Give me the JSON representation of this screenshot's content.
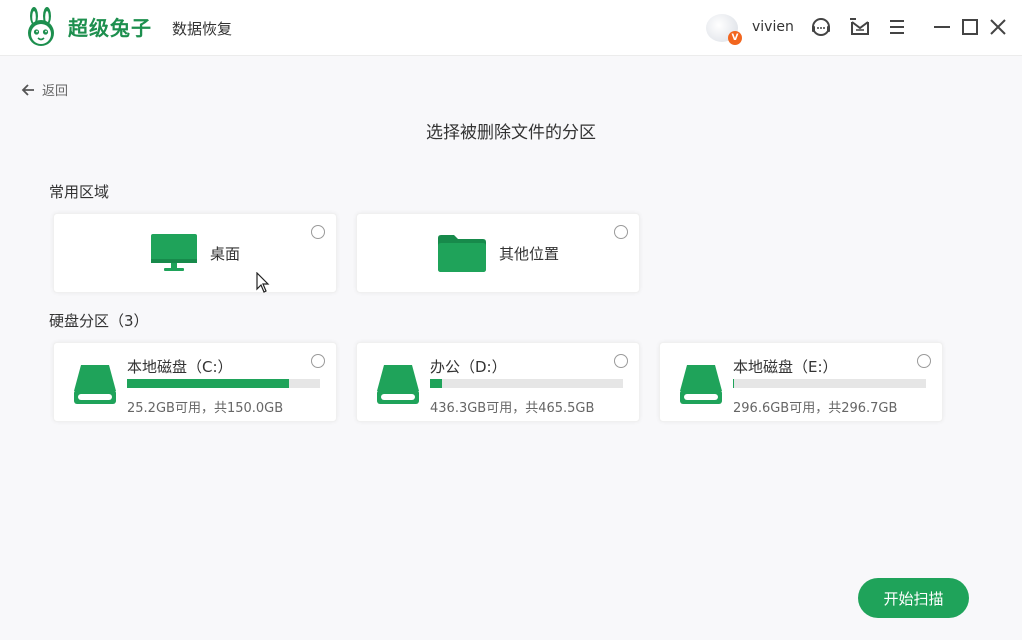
{
  "app": {
    "brand": "超级兔子",
    "subtitle": "数据恢复",
    "username": "vivien",
    "vip_badge": "V"
  },
  "icons": {
    "logo": "rabbit-logo-icon",
    "support": "headset-icon",
    "message": "mail-icon",
    "menu": "hamburger-menu-icon",
    "minimize": "minimize-icon",
    "maximize": "maximize-icon",
    "close": "close-icon",
    "back": "arrow-left-icon",
    "desktop": "monitor-icon",
    "other": "folder-icon",
    "drive": "hard-drive-icon"
  },
  "nav": {
    "back_label": "返回"
  },
  "page": {
    "title": "选择被删除文件的分区"
  },
  "common": {
    "label": "常用区域",
    "items": [
      {
        "label": "桌面"
      },
      {
        "label": "其他位置"
      }
    ]
  },
  "partitions": {
    "label": "硬盘分区（3）",
    "items": [
      {
        "name": "本地磁盘（C:）",
        "size": "25.2GB可用，共150.0GB",
        "used_fraction": 0.84
      },
      {
        "name": "办公（D:）",
        "size": "436.3GB可用，共465.5GB",
        "used_fraction": 0.063
      },
      {
        "name": "本地磁盘（E:）",
        "size": "296.6GB可用，共296.7GB",
        "used_fraction": 0.003
      }
    ]
  },
  "actions": {
    "start_scan": "开始扫描"
  },
  "colors": {
    "accent": "#1fa35a",
    "vip": "#f2661f"
  }
}
